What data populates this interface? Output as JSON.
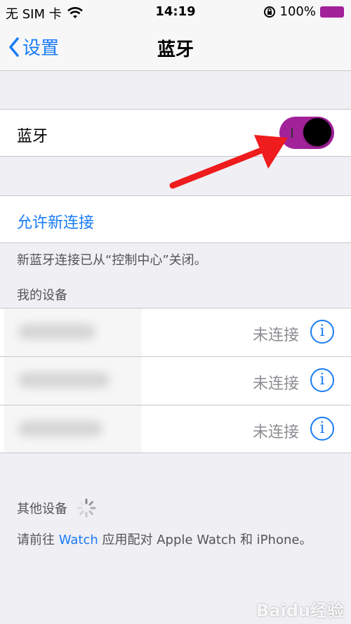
{
  "status": {
    "carrier": "无 SIM 卡",
    "time": "14:19",
    "battery": "100%"
  },
  "nav": {
    "back_label": "设置",
    "title": "蓝牙"
  },
  "bluetooth": {
    "label": "蓝牙",
    "enabled": true
  },
  "allow_new": {
    "label": "允许新连接"
  },
  "note": "新蓝牙连接已从“控制中心”关闭。",
  "my_devices": {
    "header": "我的设备",
    "items": [
      {
        "status": "未连接"
      },
      {
        "status": "未连接"
      },
      {
        "status": "未连接"
      }
    ]
  },
  "other_devices": {
    "header": "其他设备",
    "hint_prefix": "请前往",
    "hint_link": "Watch",
    "hint_suffix": "应用配对 Apple Watch 和 iPhone。"
  },
  "colors": {
    "accent": "#1a7cf5",
    "toggle_on": "#a2229a",
    "arrow": "#ee1c1c"
  },
  "watermark": "Baidu经验"
}
